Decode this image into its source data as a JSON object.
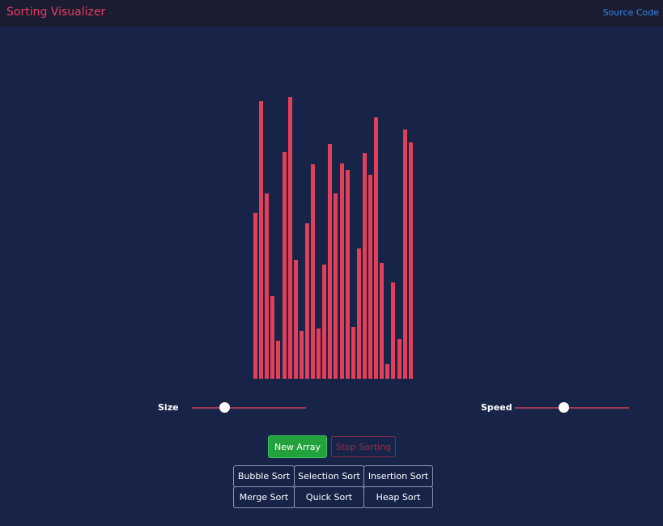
{
  "header": {
    "title": "Sorting Visualizer",
    "source_link": "Source Code"
  },
  "array": {
    "values": [
      202,
      338,
      225,
      100,
      46,
      276,
      343,
      145,
      58,
      189,
      261,
      61,
      139,
      285,
      225,
      262,
      254,
      63,
      158,
      275,
      248,
      318,
      141,
      18,
      117,
      48,
      303,
      287
    ]
  },
  "controls": {
    "size_label": "Size",
    "size_value": 0.29,
    "speed_label": "Speed",
    "speed_value": 0.43,
    "new_array_label": "New Array",
    "stop_sorting_label": "Stop Sorting"
  },
  "algorithms": [
    {
      "label": "Bubble Sort"
    },
    {
      "label": "Selection Sort"
    },
    {
      "label": "Insertion Sort"
    },
    {
      "label": "Merge Sort"
    },
    {
      "label": "Quick Sort"
    },
    {
      "label": "Heap Sort"
    }
  ],
  "colors": {
    "bar": "#e43f59",
    "background": "#172448",
    "header": "#1b1c31",
    "accent": "#e63e61"
  }
}
